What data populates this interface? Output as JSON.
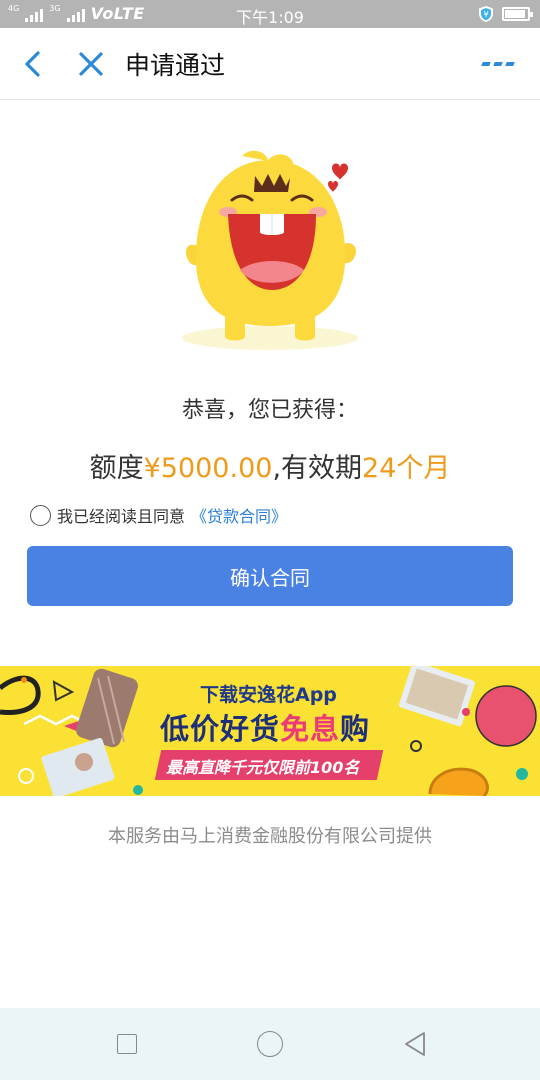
{
  "status_bar": {
    "network_label_1": "4G",
    "network_label_2": "3G",
    "volte": "VoLTE",
    "time": "下午1:09",
    "battery_level": 0.9
  },
  "header": {
    "title": "申请通过",
    "back_icon": "chevron-left-icon",
    "close_icon": "close-icon",
    "more_icon": "more-dots-icon"
  },
  "result": {
    "congrats": "恭喜，您已获得：",
    "quota_prefix": "额度",
    "quota_amount": "¥5000.00",
    "separator": ",有效期",
    "term": "24个月"
  },
  "agreement": {
    "text": "我已经阅读且同意",
    "link": "《贷款合同》",
    "checked": false
  },
  "confirm_button": "确认合同",
  "banner": {
    "line1": "下载安逸花App",
    "line2_a": "低价好货",
    "line2_b": "免息",
    "line2_c": "购",
    "line3": "最高直降千元仅限前100名"
  },
  "footer": {
    "provider": "本服务由马上消费金融股份有限公司提供"
  },
  "colors": {
    "primary_button": "#4a82e3",
    "highlight": "#f09a1b",
    "link": "#2b7fd8",
    "banner_bg": "#fbe133"
  }
}
